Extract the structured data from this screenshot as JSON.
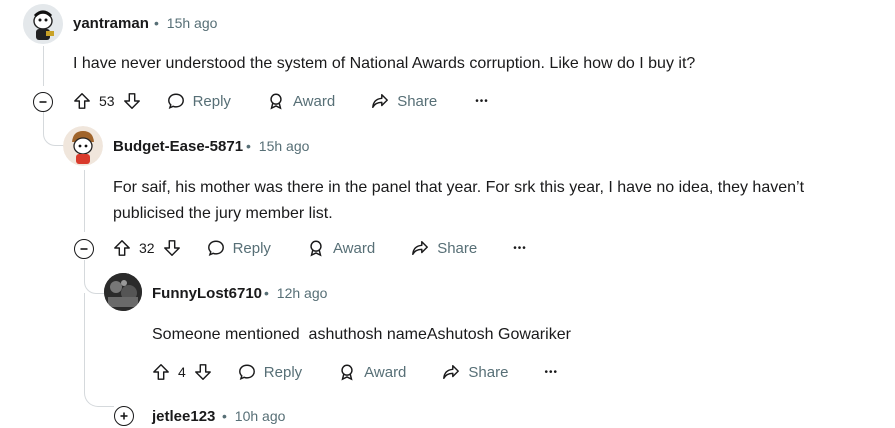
{
  "comments": [
    {
      "username": "yantraman",
      "time": "15h ago",
      "body": "I have never understood the system of National Awards corruption. Like how do I buy it?",
      "votes": "53",
      "avatar_icon": "snoo-avatar-icon"
    },
    {
      "username": "Budget-Ease-5871",
      "time": "15h ago",
      "body": "For saif, his mother was there in the panel that year. For srk this year, I have no idea, they haven’t publicised the jury member list.",
      "votes": "32",
      "avatar_icon": "snoo-avatar-icon"
    },
    {
      "username": "FunnyLost6710",
      "time": "12h ago",
      "body": "Someone mentioned  ashuthosh nameAshutosh Gowariker",
      "votes": "4",
      "avatar_icon": "profile-photo-icon"
    },
    {
      "username": "jetlee123",
      "time": "10h ago"
    }
  ],
  "actions": {
    "reply": "Reply",
    "award": "Award",
    "share": "Share",
    "more": "•••"
  },
  "separator": "•"
}
